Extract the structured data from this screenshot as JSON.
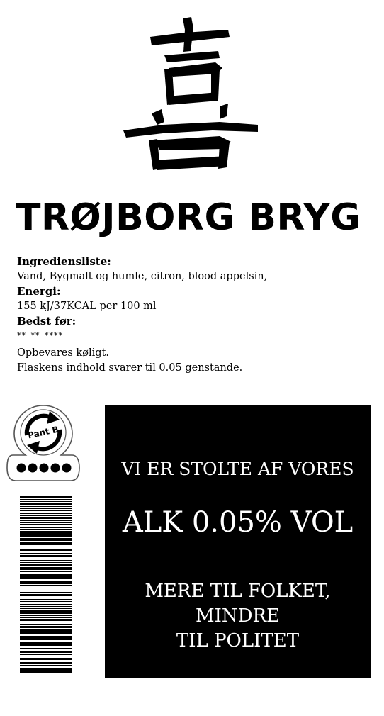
{
  "logo": {
    "icon": "kanji-logo-icon"
  },
  "brand": {
    "name": "TRØJBORG BRYG"
  },
  "info": {
    "ingredients_heading": "Ingrediensliste:",
    "ingredients": "Vand, Bygmalt og humle, citron, blood appelsin,",
    "energy_heading": "Energi:",
    "energy": "155 kJ/37KCAL per 100 ml",
    "best_before_heading": "Bedst før:",
    "best_before": "**_**_****",
    "storage": "Opbevares køligt.",
    "contents": "Flaskens indhold svarer til 0.05 genstande."
  },
  "pant": {
    "label": "Pant B",
    "icon": "recycle-deposit-icon"
  },
  "barcode": {
    "icon": "barcode-icon"
  },
  "panel": {
    "line1": "VI ER STOLTE AF VORES",
    "line2": "ALK 0.05% VOL",
    "line3": "MERE TIL FOLKET, MINDRE\nTIL POLITET"
  },
  "colors": {
    "background": "#ffffff",
    "ink": "#000000",
    "panel_text": "#ffffff"
  }
}
